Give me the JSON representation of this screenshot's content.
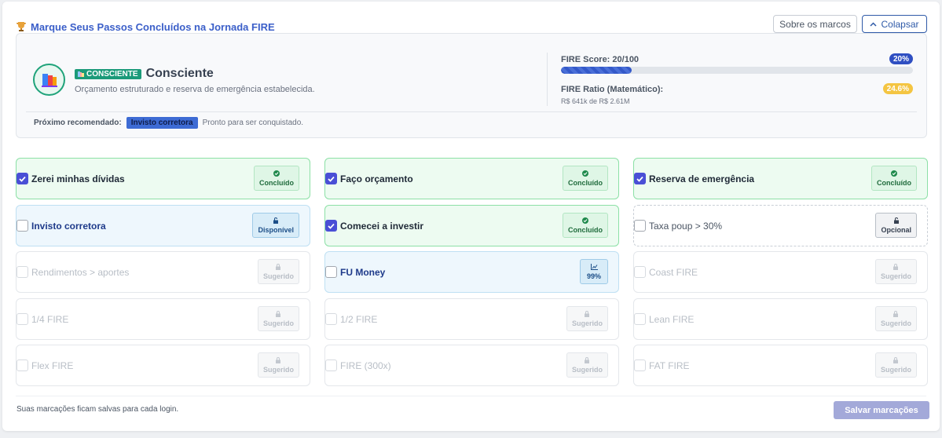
{
  "header": {
    "title": "Marque Seus Passos Concluídos na Jornada FIRE",
    "about_label": "Sobre os marcos",
    "collapse_label": "Colapsar"
  },
  "status": {
    "badge": "CONSCIENTE",
    "level_name": "Consciente",
    "level_desc": "Orçamento estruturado e reserva de emergência estabelecida.",
    "score_label": "FIRE Score: 20/100",
    "score_pct": "20%",
    "score_value": 20,
    "ratio_label": "FIRE Ratio (Matemático):",
    "ratio_pct": "24.6%",
    "ratio_sub": "R$ 641k de R$ 2.61M",
    "next_label": "Próximo recomendado:",
    "next_chip": "Invisto corretora",
    "next_desc": "Pronto para ser conquistado."
  },
  "milestones": [
    {
      "label": "Zerei minhas dívidas",
      "tag": "Concluído",
      "state": "done"
    },
    {
      "label": "Faço orçamento",
      "tag": "Concluído",
      "state": "done"
    },
    {
      "label": "Reserva de emergência",
      "tag": "Concluído",
      "state": "done"
    },
    {
      "label": "Invisto corretora",
      "tag": "Disponível",
      "state": "avail"
    },
    {
      "label": "Comecei a investir",
      "tag": "Concluído",
      "state": "done"
    },
    {
      "label": "Taxa poup > 30%",
      "tag": "Opcional",
      "state": "opt"
    },
    {
      "label": "Rendimentos > aportes",
      "tag": "Sugerido",
      "state": "sugg"
    },
    {
      "label": "FU Money",
      "tag": "99%",
      "state": "pct"
    },
    {
      "label": "Coast FIRE",
      "tag": "Sugerido",
      "state": "sugg"
    },
    {
      "label": "1/4 FIRE",
      "tag": "Sugerido",
      "state": "sugg"
    },
    {
      "label": "1/2 FIRE",
      "tag": "Sugerido",
      "state": "sugg"
    },
    {
      "label": "Lean FIRE",
      "tag": "Sugerido",
      "state": "sugg"
    },
    {
      "label": "Flex FIRE",
      "tag": "Sugerido",
      "state": "sugg"
    },
    {
      "label": "FIRE (300x)",
      "tag": "Sugerido",
      "state": "sugg"
    },
    {
      "label": "FAT FIRE",
      "tag": "Sugerido",
      "state": "sugg"
    }
  ],
  "footer": {
    "note": "Suas marcações ficam salvas para cada login.",
    "save_label": "Salvar marcações"
  },
  "colors": {
    "accent": "#3b5fc9",
    "done_border": "#8ce0a6",
    "check": "#4a4fd6",
    "badge_green": "#1b9a79"
  }
}
